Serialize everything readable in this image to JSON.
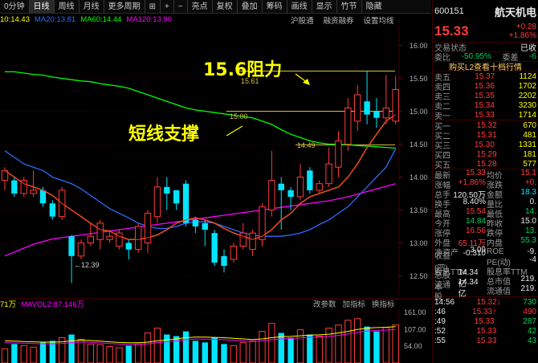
{
  "toolbar": {
    "items": [
      "0分钟",
      "日线",
      "周线",
      "月线",
      "更多周期",
      "⊞",
      "+",
      "−",
      "亮点",
      "复权",
      "叠加",
      "筹码",
      "画线",
      "显示",
      "竹节",
      "隐藏"
    ],
    "active_index": 1
  },
  "ma_legend": [
    {
      "label": "10:14.43",
      "color": "#ffff00"
    },
    {
      "label": "MA20:13.81",
      "color": "#2e6bff"
    },
    {
      "label": "MA60:14.44",
      "color": "#00ff00"
    },
    {
      "label": "MA120:13.90",
      "color": "#ff00ff"
    }
  ],
  "ma_right": [
    "沪股通",
    "融资融券",
    "设置均线"
  ],
  "price_axis": [
    "16.00",
    "15.50",
    "15.00",
    "14.50",
    "14.00",
    "13.50",
    "13.00",
    "12.50"
  ],
  "annotations": {
    "resist_big": "15.6阻力",
    "resist_small": "15.61",
    "support_big": "短线支撑",
    "support_small": "15.00",
    "level_1449": "14.49",
    "low_label": "←12.39"
  },
  "volume": {
    "prefix": "71万",
    "mavol2": "MAVOL2:87.146万",
    "tools": [
      "改参数",
      "加指标",
      "换指标"
    ],
    "axis": [
      "161.00",
      "107.00",
      "54.00"
    ]
  },
  "quote": {
    "code": "600151",
    "name": "航天机电",
    "price": "15.33",
    "change": "+0.28",
    "change_pct": "+1.86%",
    "status": "交易状态",
    "status_right": "已收",
    "weibi_label": "委比",
    "weibi": "-50.95%",
    "weicha_label": "委差",
    "weicha": "-6",
    "l2": "购买L2查看十档行情",
    "asks": [
      {
        "label": "卖五",
        "price": "15.37",
        "vol": "1124"
      },
      {
        "label": "卖四",
        "price": "15.36",
        "vol": "1702"
      },
      {
        "label": "卖三",
        "price": "15.35",
        "vol": "2202"
      },
      {
        "label": "卖二",
        "price": "15.34",
        "vol": "3230"
      },
      {
        "label": "卖一",
        "price": "15.33",
        "vol": "1714"
      }
    ],
    "bids": [
      {
        "label": "买一",
        "price": "15.32",
        "vol": "670"
      },
      {
        "label": "买二",
        "price": "15.31",
        "vol": "481"
      },
      {
        "label": "买三",
        "price": "15.30",
        "vol": "1331"
      },
      {
        "label": "买四",
        "price": "15.29",
        "vol": "181"
      },
      {
        "label": "买五",
        "price": "15.28",
        "vol": "577"
      }
    ],
    "stats": [
      [
        "最新",
        "15.33",
        "red",
        "均价",
        "15.1",
        "red"
      ],
      [
        "涨幅",
        "+1.86%",
        "red",
        "涨跌",
        "+0.",
        "red"
      ],
      [
        "总手",
        "120.50万",
        "white",
        "金额",
        "18.3",
        "cyan"
      ],
      [
        "换手",
        "8.40%",
        "white",
        "量比",
        "0.",
        "white"
      ],
      [
        "最高",
        "15.54",
        "red",
        "最低",
        "14.",
        "green"
      ],
      [
        "今开",
        "14.84",
        "green",
        "昨收",
        "15.0",
        "white"
      ],
      [
        "涨停",
        "16.56",
        "red",
        "跌停",
        "13.",
        "green"
      ],
      [
        "外盘",
        "65.11万",
        "red",
        "内盘",
        "55.3",
        "green"
      ],
      [
        "净资产",
        "3.09",
        "white",
        "ROE",
        "-9.",
        "white"
      ],
      [
        "收益(四)",
        "-0.310",
        "white",
        "PE(动)",
        "-4",
        "white"
      ],
      [
        "股息TTM",
        "",
        "white",
        "股息率TTM",
        "",
        "white"
      ],
      [
        "总股本",
        "14.34亿",
        "white",
        "总市值",
        "219.",
        "white"
      ],
      [
        "流通股",
        "14.34亿",
        "white",
        "流通值",
        "219.",
        "white"
      ]
    ],
    "ticks": [
      {
        "time": "14:56",
        "price": "15.32",
        "arrow": "↓",
        "vol": "730",
        "vc": "green"
      },
      {
        "time": ":46",
        "price": "15.33",
        "arrow": "↑",
        "vol": "490",
        "vc": "red"
      },
      {
        "time": ":49",
        "price": "15.33",
        "arrow": "",
        "vol": "287",
        "vc": "green"
      },
      {
        "time": ":52",
        "price": "15.33",
        "arrow": "",
        "vol": "42",
        "vc": "green"
      },
      {
        "time": ":55",
        "price": "15.33",
        "arrow": "",
        "vol": "43",
        "vc": "green"
      }
    ]
  },
  "chart_data": {
    "type": "candlestick",
    "ylim": [
      12.2,
      16.3
    ],
    "candles": [
      [
        13.95,
        14.1,
        13.8,
        14.15
      ],
      [
        13.95,
        13.75,
        13.7,
        14.0
      ],
      [
        13.75,
        13.95,
        13.7,
        14.0
      ],
      [
        13.75,
        13.8,
        13.7,
        14.1
      ],
      [
        13.8,
        13.6,
        13.55,
        13.85
      ],
      [
        13.6,
        13.4,
        13.35,
        13.65
      ],
      [
        13.4,
        13.8,
        13.35,
        13.85
      ],
      [
        13.1,
        12.8,
        12.39,
        13.12
      ],
      [
        12.8,
        13.0,
        12.75,
        13.05
      ],
      [
        13.0,
        13.1,
        12.95,
        13.3
      ],
      [
        13.05,
        13.3,
        12.9,
        13.35
      ],
      [
        13.05,
        13.1,
        13.0,
        13.2
      ],
      [
        12.95,
        13.15,
        12.9,
        13.2
      ],
      [
        13.0,
        12.9,
        12.75,
        13.05
      ],
      [
        12.9,
        13.25,
        12.85,
        13.3
      ],
      [
        13.0,
        13.45,
        12.85,
        13.5
      ],
      [
        13.4,
        13.85,
        13.3,
        14.0
      ],
      [
        13.85,
        13.75,
        13.5,
        14.0
      ],
      [
        13.8,
        13.6,
        13.5,
        13.8
      ],
      [
        13.9,
        13.3,
        13.25,
        13.95
      ],
      [
        13.35,
        13.25,
        13.15,
        13.4
      ],
      [
        13.3,
        13.2,
        12.95,
        13.35
      ],
      [
        13.15,
        12.7,
        12.65,
        13.2
      ],
      [
        12.8,
        12.65,
        12.55,
        12.9
      ],
      [
        12.75,
        12.95,
        12.7,
        13.0
      ],
      [
        12.95,
        13.15,
        12.9,
        13.3
      ],
      [
        12.9,
        13.15,
        12.8,
        13.2
      ],
      [
        13.05,
        13.55,
        12.95,
        13.6
      ],
      [
        13.5,
        13.95,
        13.4,
        14.4
      ],
      [
        13.9,
        13.8,
        13.2,
        14.0
      ],
      [
        13.8,
        13.7,
        13.5,
        13.85
      ],
      [
        13.7,
        14.0,
        13.65,
        14.2
      ],
      [
        14.1,
        13.8,
        13.75,
        14.15
      ],
      [
        13.8,
        13.9,
        13.75,
        13.95
      ],
      [
        13.9,
        14.2,
        13.85,
        14.45
      ],
      [
        14.15,
        14.55,
        14.0,
        14.7
      ],
      [
        14.5,
        15.05,
        14.4,
        15.2
      ],
      [
        14.85,
        15.25,
        14.7,
        15.4
      ],
      [
        15.15,
        14.95,
        14.8,
        15.61
      ],
      [
        15.0,
        14.9,
        14.75,
        15.2
      ],
      [
        14.9,
        15.05,
        14.8,
        15.55
      ],
      [
        14.85,
        15.33,
        14.8,
        15.54
      ]
    ],
    "ma10": [
      14.1,
      14.0,
      13.9,
      13.85,
      13.8,
      13.72,
      13.6,
      13.5,
      13.4,
      13.3,
      13.2,
      13.18,
      13.1,
      13.05,
      13.05,
      13.08,
      13.12,
      13.2,
      13.3,
      13.35,
      13.38,
      13.35,
      13.3,
      13.22,
      13.15,
      13.1,
      13.05,
      13.1,
      13.2,
      13.35,
      13.45,
      13.6,
      13.7,
      13.75,
      13.8,
      13.85,
      14.0,
      14.2,
      14.45,
      14.65,
      14.85,
      14.95
    ],
    "ma20": [
      14.4,
      14.3,
      14.2,
      14.15,
      14.1,
      14.0,
      13.95,
      13.9,
      13.82,
      13.72,
      13.62,
      13.52,
      13.45,
      13.38,
      13.3,
      13.25,
      13.22,
      13.22,
      13.25,
      13.3,
      13.32,
      13.32,
      13.3,
      13.25,
      13.2,
      13.15,
      13.12,
      13.1,
      13.1,
      13.1,
      13.12,
      13.15,
      13.2,
      13.28,
      13.35,
      13.45,
      13.55,
      13.7,
      13.85,
      14.0,
      14.15,
      14.43
    ],
    "ma60": [
      15.6,
      15.6,
      15.58,
      15.56,
      15.55,
      15.52,
      15.5,
      15.48,
      15.46,
      15.45,
      15.42,
      15.4,
      15.38,
      15.35,
      15.3,
      15.25,
      15.2,
      15.15,
      15.1,
      15.05,
      15.02,
      15.0,
      14.98,
      14.96,
      14.94,
      14.92,
      14.9,
      14.85,
      14.8,
      14.72,
      14.65,
      14.6,
      14.55,
      14.52,
      14.5,
      14.5,
      14.49,
      14.48,
      14.47,
      14.46,
      14.45,
      14.44
    ],
    "ma120": [
      12.8,
      12.86,
      12.92,
      12.98,
      13.02,
      13.06,
      13.08,
      13.1,
      13.12,
      13.14,
      13.16,
      13.18,
      13.2,
      13.22,
      13.24,
      13.26,
      13.28,
      13.3,
      13.32,
      13.34,
      13.36,
      13.38,
      13.4,
      13.42,
      13.44,
      13.46,
      13.48,
      13.5,
      13.52,
      13.54,
      13.56,
      13.58,
      13.6,
      13.62,
      13.64,
      13.67,
      13.7,
      13.74,
      13.78,
      13.82,
      13.86,
      13.9
    ],
    "volume_ylim": [
      0,
      170
    ],
    "volume": [
      45,
      60,
      55,
      50,
      65,
      70,
      80,
      90,
      75,
      60,
      58,
      52,
      48,
      55,
      60,
      95,
      110,
      90,
      85,
      100,
      70,
      65,
      80,
      60,
      55,
      65,
      70,
      100,
      125,
      95,
      80,
      105,
      90,
      85,
      110,
      120,
      135,
      140,
      115,
      100,
      112,
      120
    ],
    "mavol": [
      70,
      69,
      68,
      67,
      66,
      66,
      67,
      70,
      72,
      71,
      69,
      67,
      65,
      64,
      64,
      66,
      70,
      73,
      76,
      80,
      82,
      82,
      81,
      80,
      78,
      76,
      74,
      76,
      80,
      83,
      84,
      86,
      88,
      89,
      91,
      95,
      100,
      106,
      110,
      112,
      113,
      115
    ]
  }
}
